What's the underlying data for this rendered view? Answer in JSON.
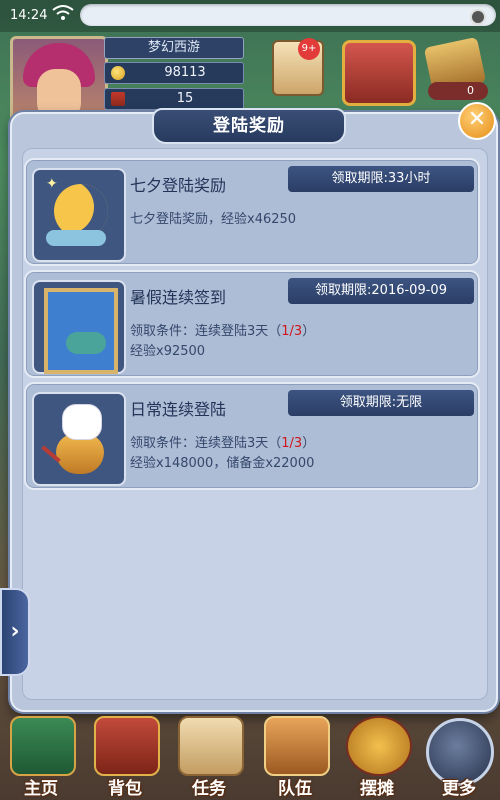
{
  "status_bar": {
    "time": "14:24"
  },
  "player": {
    "name": "梦幻西游",
    "gold": "98113",
    "items": "15"
  },
  "top_icons": {
    "badge": "9+",
    "counter": "0"
  },
  "dialog": {
    "title": "登陆奖励",
    "close_symbol": "✕",
    "cards": [
      {
        "icon": "moon-icon",
        "title": "七夕登陆奖励",
        "deadline": "领取期限:33小时",
        "line1": "七夕登陆奖励，经验x46250"
      },
      {
        "icon": "fish-painting-icon",
        "title": "暑假连续签到",
        "deadline": "领取期限:2016-09-09",
        "condition_prefix": "领取条件：连续登陆3天（",
        "progress": "1/3",
        "condition_suffix": "）",
        "line2": "经验x92500"
      },
      {
        "icon": "lucky-cat-pot-icon",
        "title": "日常连续登陆",
        "deadline": "领取期限:无限",
        "condition_prefix": "领取条件：连续登陆3天（",
        "progress": "1/3",
        "condition_suffix": "）",
        "line2": "经验x148000，储备金x22000"
      }
    ]
  },
  "side_arrow": "›",
  "bottom_nav": [
    {
      "label": "主页",
      "icon": "pagoda-icon"
    },
    {
      "label": "背包",
      "icon": "chest-icon"
    },
    {
      "label": "任务",
      "icon": "scroll-icon"
    },
    {
      "label": "队伍",
      "icon": "team-icon"
    },
    {
      "label": "摆摊",
      "icon": "stall-icon"
    },
    {
      "label": "更多",
      "icon": "more-icon"
    }
  ]
}
